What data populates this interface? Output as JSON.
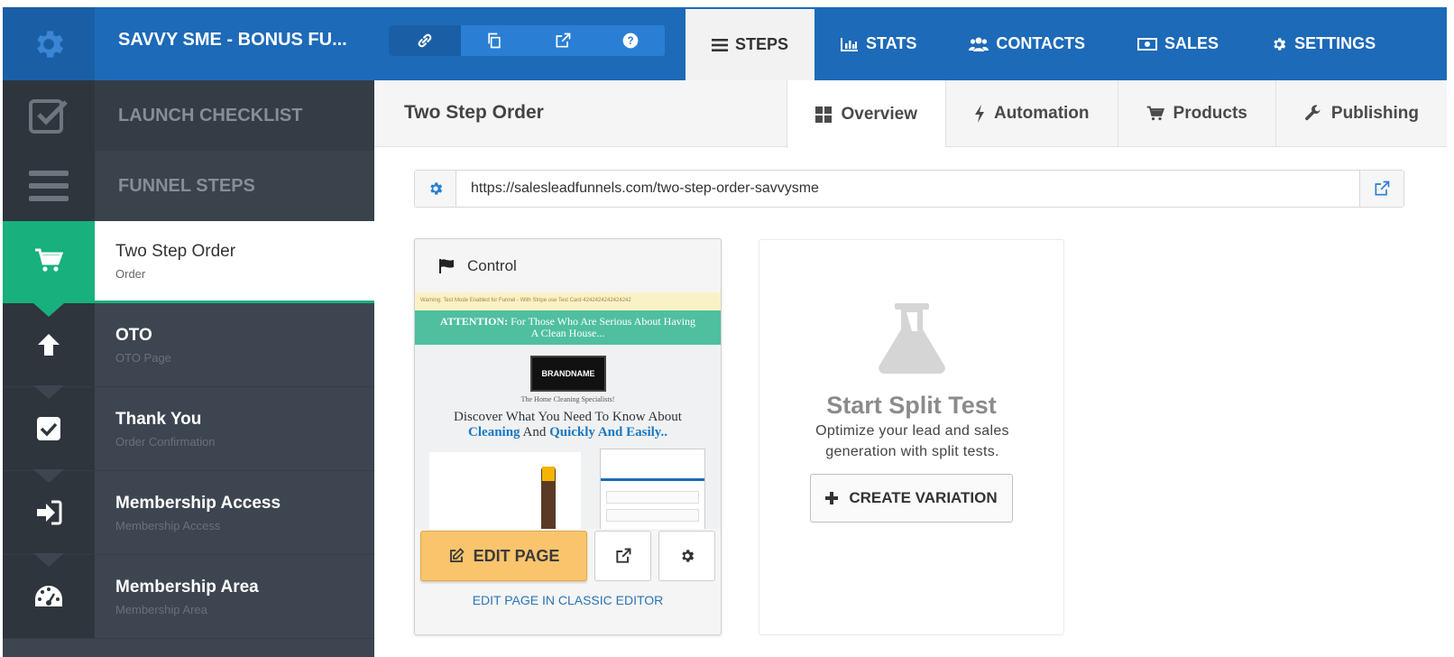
{
  "header": {
    "funnel_title": "SAVVY SME - BONUS FU...",
    "tools": [
      "link-icon",
      "copy-icon",
      "external-link-icon",
      "help-icon"
    ],
    "nav": [
      {
        "label": "STEPS",
        "icon": "bars-icon",
        "active": true
      },
      {
        "label": "STATS",
        "icon": "bar-chart-icon"
      },
      {
        "label": "CONTACTS",
        "icon": "users-icon"
      },
      {
        "label": "SALES",
        "icon": "money-icon"
      },
      {
        "label": "SETTINGS",
        "icon": "gear-icon"
      }
    ]
  },
  "sidebar": {
    "launch_checklist": "LAUNCH CHECKLIST",
    "funnel_steps": "FUNNEL STEPS",
    "steps": [
      {
        "name": "Two Step Order",
        "sub": "Order",
        "icon": "cart-icon",
        "active": true
      },
      {
        "name": "OTO",
        "sub": "OTO Page",
        "icon": "arrow-up-icon"
      },
      {
        "name": "Thank You",
        "sub": "Order Confirmation",
        "icon": "check-square-icon"
      },
      {
        "name": "Membership Access",
        "sub": "Membership Access",
        "icon": "sign-in-icon"
      },
      {
        "name": "Membership Area",
        "sub": "Membership Area",
        "icon": "dashboard-icon"
      }
    ]
  },
  "main": {
    "title": "Two Step Order",
    "tabs": [
      {
        "label": "Overview",
        "icon": "grid-icon",
        "active": true
      },
      {
        "label": "Automation",
        "icon": "bolt-icon"
      },
      {
        "label": "Products",
        "icon": "cart-icon"
      },
      {
        "label": "Publishing",
        "icon": "wrench-icon"
      }
    ],
    "url": "https://salesleadfunnels.com/two-step-order-savvysme",
    "variant": {
      "label": "Control",
      "preview": {
        "warning": "Warning: Test Mode Enabled for Funnel - With Stripe use Test Card 4242424242424242",
        "attention_bold": "ATTENTION:",
        "attention_text": "For Those Who Are Serious About Having A Clean House...",
        "brand": "BRANDNAME",
        "tagline": "The Home Cleaning Specialists!",
        "headline_1": "Discover What You Need To Know About",
        "headline_2a": "Cleaning",
        "headline_2b": "And",
        "headline_2c": "Quickly And Easily.."
      },
      "edit_label": "EDIT PAGE",
      "classic_label": "EDIT PAGE IN CLASSIC EDITOR"
    },
    "split": {
      "title": "Start Split Test",
      "desc": "Optimize your lead and sales generation with split tests.",
      "button": "CREATE VARIATION"
    }
  },
  "colors": {
    "topbar": "#1d6ab8",
    "sidebar": "#3d4650",
    "active_green": "#18b07c",
    "edit_button": "#f9c46c"
  }
}
